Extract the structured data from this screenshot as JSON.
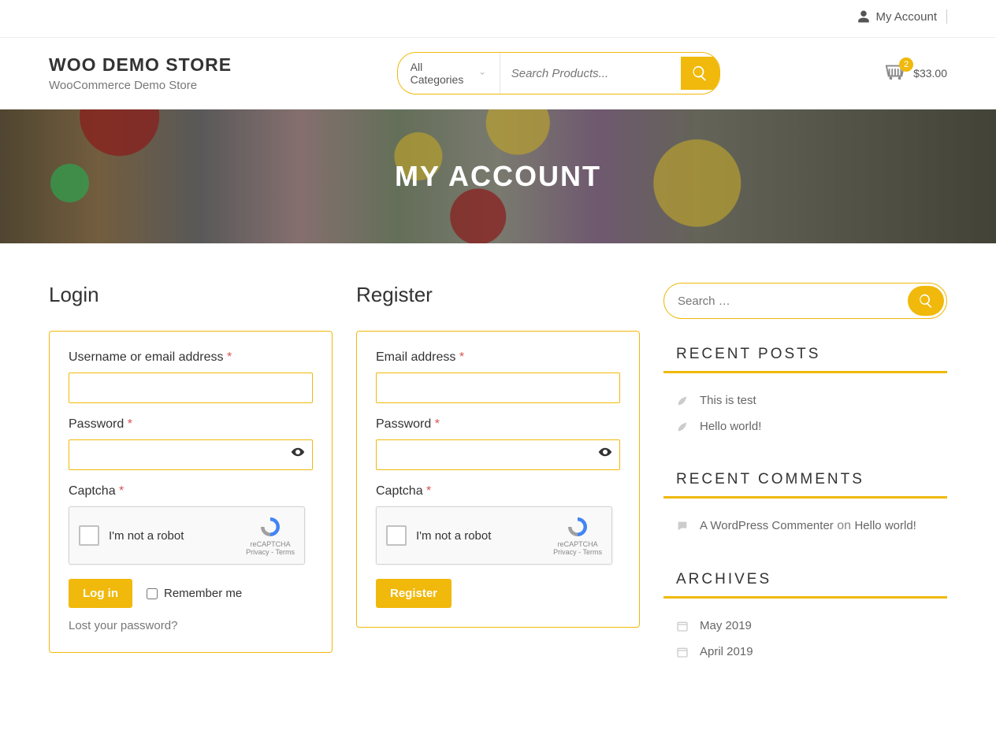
{
  "topbar": {
    "account_label": "My Account"
  },
  "header": {
    "title": "WOO DEMO STORE",
    "subtitle": "WooCommerce Demo Store",
    "category_label": "All Categories",
    "search_placeholder": "Search Products...",
    "cart": {
      "count": "2",
      "total": "$33.00"
    }
  },
  "hero": {
    "title": "MY ACCOUNT"
  },
  "login": {
    "heading": "Login",
    "username_label": "Username or email address",
    "password_label": "Password",
    "captcha_label": "Captcha",
    "recaptcha_text": "I'm not a robot",
    "recaptcha_brand": "reCAPTCHA",
    "recaptcha_terms": "Privacy - Terms",
    "submit_label": "Log in",
    "remember_label": "Remember me",
    "lost_label": "Lost your password?"
  },
  "register": {
    "heading": "Register",
    "email_label": "Email address",
    "password_label": "Password",
    "captcha_label": "Captcha",
    "recaptcha_text": "I'm not a robot",
    "recaptcha_brand": "reCAPTCHA",
    "recaptcha_terms": "Privacy - Terms",
    "submit_label": "Register"
  },
  "sidebar": {
    "search_placeholder": "Search …",
    "recent_posts": {
      "title": "RECENT POSTS",
      "items": [
        "This is test",
        "Hello world!"
      ]
    },
    "recent_comments": {
      "title": "RECENT COMMENTS",
      "author": "A WordPress Commenter",
      "on": " on ",
      "post": "Hello world!"
    },
    "archives": {
      "title": "ARCHIVES",
      "items": [
        "May 2019",
        "April 2019"
      ]
    }
  }
}
